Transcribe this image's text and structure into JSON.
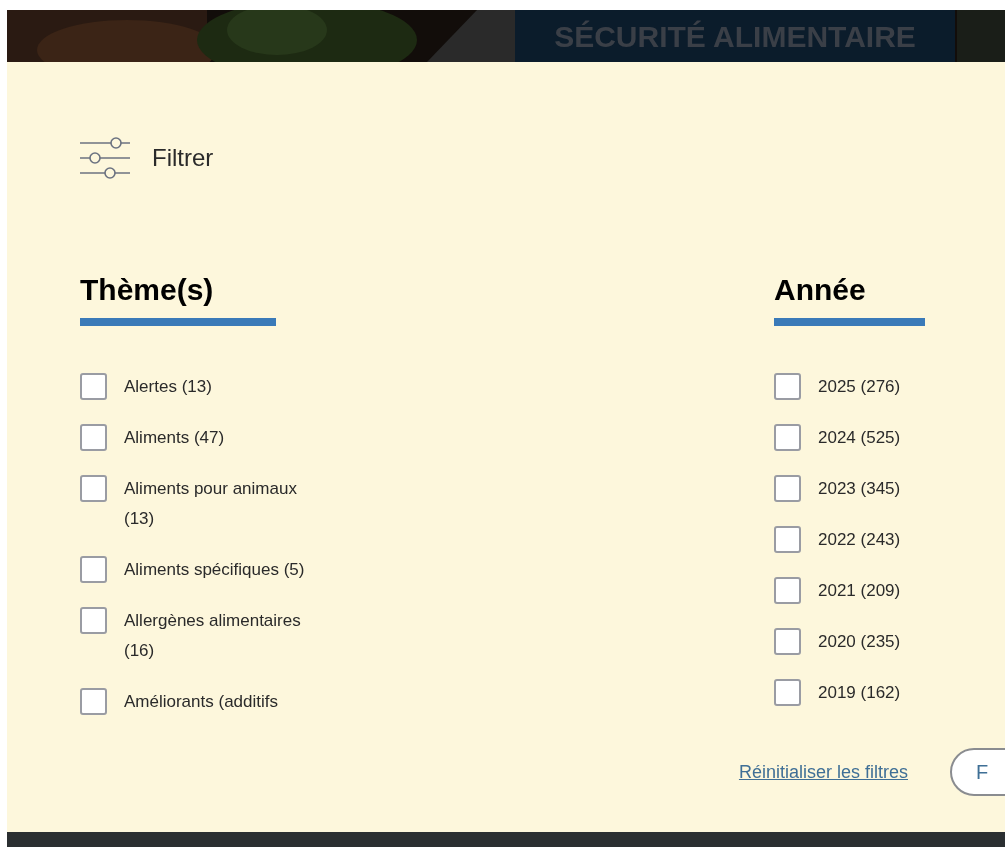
{
  "banner": {
    "kind": "picture",
    "title": "SÉCURITÉ ALIMENTAIRE"
  },
  "filter": {
    "label": "Filtrer"
  },
  "groups": [
    {
      "title": "Thème(s)",
      "options": [
        {
          "label": "Alertes (13)",
          "checked": false
        },
        {
          "label": "Aliments (47)",
          "checked": false
        },
        {
          "label": "Aliments pour animaux (13)",
          "checked": false
        },
        {
          "label": "Aliments spécifiques (5)",
          "checked": false
        },
        {
          "label": "Allergènes alimentaires (16)",
          "checked": false
        },
        {
          "label": "Améliorants (additifs",
          "checked": false
        }
      ]
    },
    {
      "title": "Année",
      "options": [
        {
          "label": "2025 (276)",
          "checked": false
        },
        {
          "label": "2024 (525)",
          "checked": false
        },
        {
          "label": "2023 (345)",
          "checked": false
        },
        {
          "label": "2022 (243)",
          "checked": false
        },
        {
          "label": "2021 (209)",
          "checked": false
        },
        {
          "label": "2020 (235)",
          "checked": false
        },
        {
          "label": "2019 (162)",
          "checked": false
        }
      ]
    }
  ],
  "actions": {
    "reset_link": "Réinitialiser les filtres",
    "submit_button": "F"
  }
}
